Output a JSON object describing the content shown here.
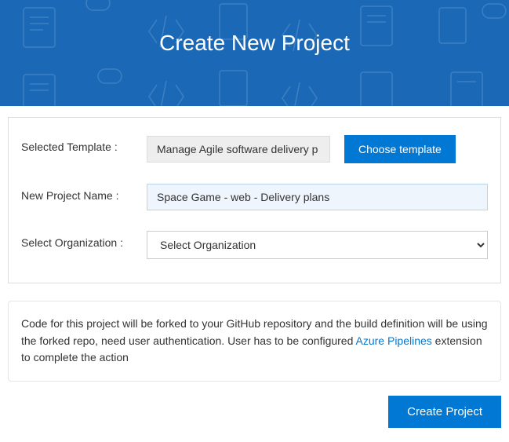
{
  "header": {
    "title": "Create New Project"
  },
  "form": {
    "template": {
      "label": "Selected Template :",
      "value": "Manage Agile software delivery p",
      "choose_button": "Choose template"
    },
    "project_name": {
      "label": "New Project Name :",
      "value": "Space Game - web - Delivery plans"
    },
    "organization": {
      "label": "Select Organization :",
      "placeholder": "Select Organization"
    }
  },
  "info": {
    "text_before": "Code for this project will be forked to your GitHub repository and the build definition will be using the forked repo, need user authentication. User has to be configured ",
    "link_text": "Azure Pipelines",
    "text_after": " extension to complete the action"
  },
  "footer": {
    "create_button": "Create Project"
  }
}
